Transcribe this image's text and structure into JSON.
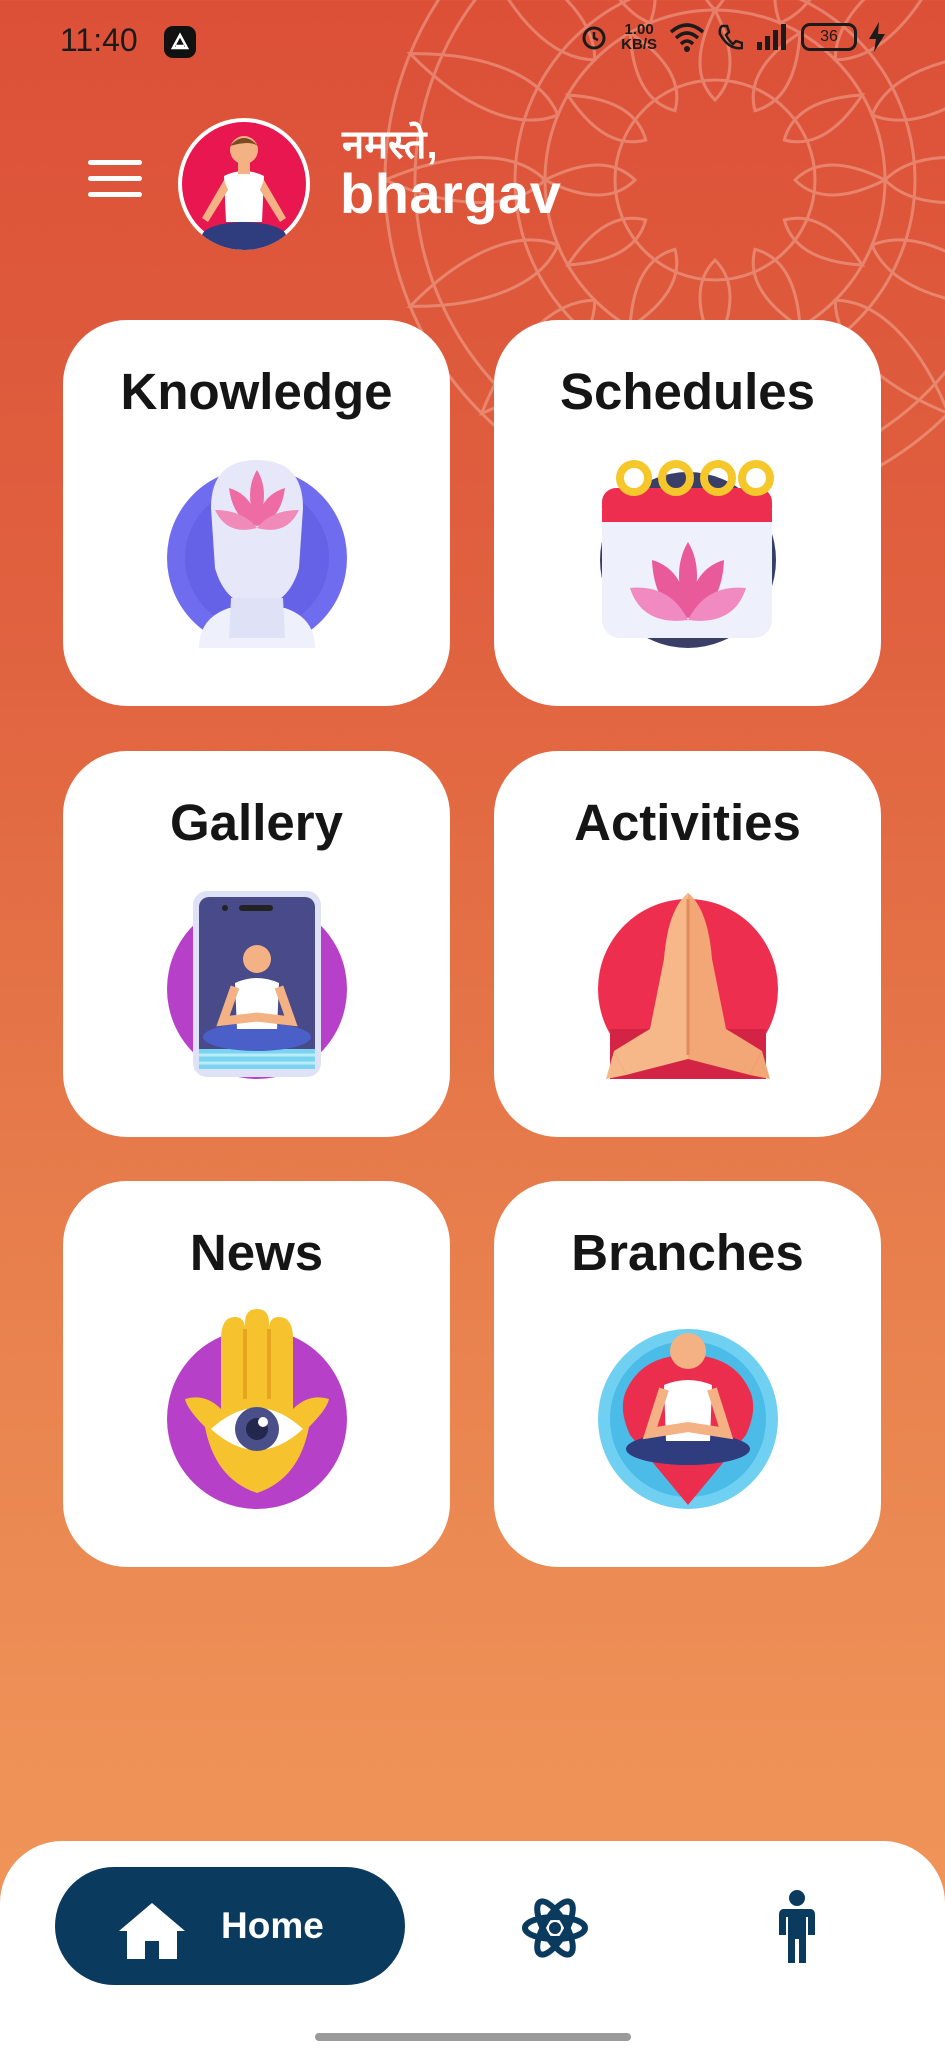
{
  "status_bar": {
    "time": "11:40",
    "speed_value": "1.00",
    "speed_unit": "KB/S",
    "battery": "36"
  },
  "header": {
    "greeting": "नमस्ते,",
    "username": "bhargav"
  },
  "cards": [
    {
      "title": "Knowledge",
      "icon": "lotus-head-icon"
    },
    {
      "title": "Schedules",
      "icon": "lotus-calendar-icon"
    },
    {
      "title": "Gallery",
      "icon": "phone-yoga-icon"
    },
    {
      "title": "Activities",
      "icon": "namaste-hands-icon"
    },
    {
      "title": "News",
      "icon": "hamsa-eye-icon"
    },
    {
      "title": "Branches",
      "icon": "yoga-location-icon"
    }
  ],
  "bottom_nav": {
    "home_label": "Home",
    "items": [
      "home-icon",
      "atom-icon",
      "person-icon"
    ]
  },
  "colors": {
    "nav_active": "#0a3a5e",
    "background_top": "#dc5038",
    "background_bottom": "#f0965a"
  }
}
